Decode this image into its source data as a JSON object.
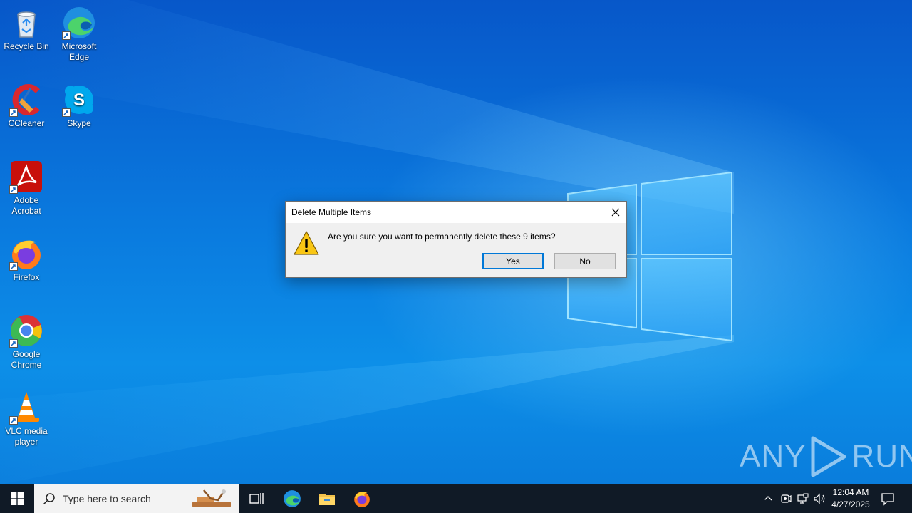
{
  "desktop": {
    "icons": [
      {
        "label_line1": "Recycle Bin",
        "label_line2": "",
        "icon": "recycle-bin-icon"
      },
      {
        "label_line1": "Microsoft",
        "label_line2": "Edge",
        "icon": "edge-icon"
      },
      {
        "label_line1": "CCleaner",
        "label_line2": "",
        "icon": "ccleaner-icon"
      },
      {
        "label_line1": "Skype",
        "label_line2": "",
        "icon": "skype-icon"
      },
      {
        "label_line1": "Adobe",
        "label_line2": "Acrobat",
        "icon": "acrobat-icon"
      },
      {
        "label_line1": "Firefox",
        "label_line2": "",
        "icon": "firefox-icon"
      },
      {
        "label_line1": "Google",
        "label_line2": "Chrome",
        "icon": "chrome-icon"
      },
      {
        "label_line1": "VLC media",
        "label_line2": "player",
        "icon": "vlc-icon"
      }
    ]
  },
  "dialog": {
    "title": "Delete Multiple Items",
    "message": "Are you sure you want to permanently delete these 9 items?",
    "yes_label": "Yes",
    "no_label": "No"
  },
  "watermark": {
    "left": "ANY",
    "right": "RUN"
  },
  "taskbar": {
    "search_placeholder": "Type here to search",
    "pinned": [
      "task-view-icon",
      "edge-icon",
      "file-explorer-icon",
      "firefox-icon"
    ],
    "clock": {
      "time": "12:04 AM",
      "date": "4/27/2025"
    }
  },
  "colors": {
    "accent": "#0078d7",
    "taskbar": "#101a26",
    "dialog_bg": "#f0f0f0"
  }
}
